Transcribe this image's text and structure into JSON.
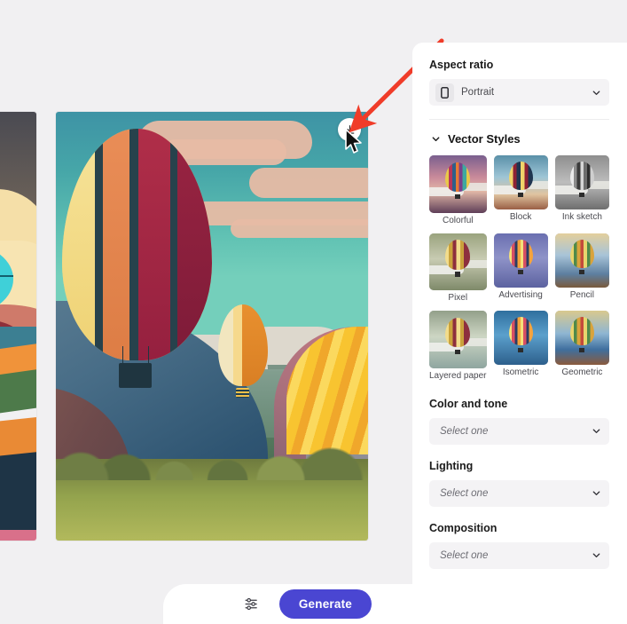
{
  "canvas": {
    "main_image_action": {
      "icon": "download-icon",
      "tooltip": ""
    },
    "previous_image_alt": "Hot air balloon over dusk valley",
    "main_image_alt": "Hot air balloons over a green valley"
  },
  "bottom_bar": {
    "settings_icon": "sliders-icon",
    "generate_label": "Generate"
  },
  "panel": {
    "aspect_ratio": {
      "title": "Aspect ratio",
      "icon": "portrait-rectangle-icon",
      "selected": "Portrait",
      "chevron": "chevron-down-icon"
    },
    "vector_styles": {
      "title": "Vector Styles",
      "chevron": "chevron-down-icon",
      "styles": [
        {
          "label": "Colorful"
        },
        {
          "label": "Block"
        },
        {
          "label": "Ink sketch"
        },
        {
          "label": "Pixel"
        },
        {
          "label": "Advertising"
        },
        {
          "label": "Pencil"
        },
        {
          "label": "Layered paper"
        },
        {
          "label": "Isometric"
        },
        {
          "label": "Geometric"
        }
      ]
    },
    "color_and_tone": {
      "title": "Color and tone",
      "placeholder": "Select one",
      "chevron": "chevron-down-icon"
    },
    "lighting": {
      "title": "Lighting",
      "placeholder": "Select one",
      "chevron": "chevron-down-icon"
    },
    "composition": {
      "title": "Composition",
      "placeholder": "Select one",
      "chevron": "chevron-down-icon"
    }
  },
  "annotation": {
    "arrow_color": "#f03c29",
    "points_to": "image-action-button"
  },
  "colors": {
    "page_background": "#f1f0f2",
    "panel_background": "#ffffff",
    "accent": "#4a46d2",
    "field_background": "#f4f3f5"
  }
}
